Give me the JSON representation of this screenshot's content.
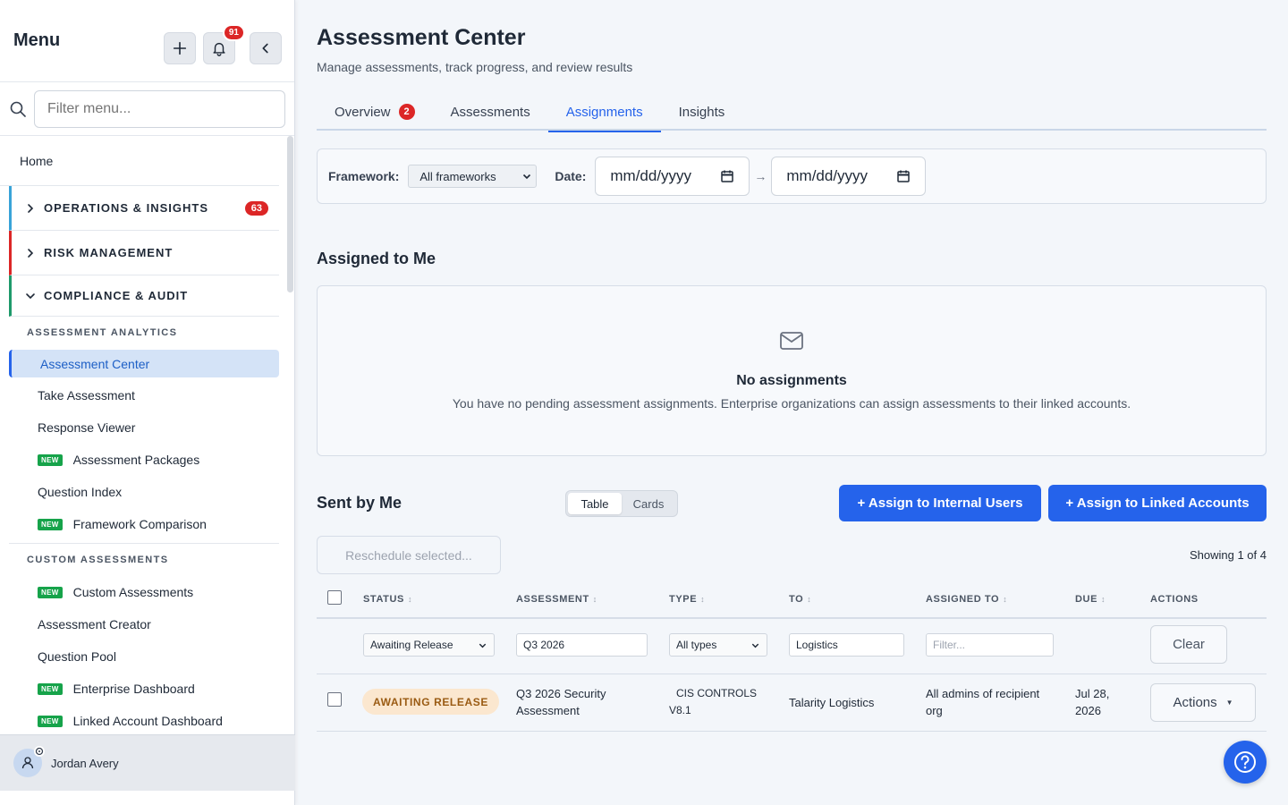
{
  "sidebar": {
    "title": "Menu",
    "notification_count": "91",
    "search_placeholder": "Filter menu...",
    "home": "Home",
    "sections": [
      {
        "label": "OPERATIONS & INSIGHTS",
        "badge": "63",
        "color": "#38a3d8"
      },
      {
        "label": "RISK MANAGEMENT",
        "color": "#dc2626"
      },
      {
        "label": "COMPLIANCE & AUDIT",
        "color": "#1e9a6b"
      }
    ],
    "groups": [
      {
        "label": "ASSESSMENT ANALYTICS",
        "items": [
          {
            "label": "Assessment Center",
            "active": true
          },
          {
            "label": "Take Assessment"
          },
          {
            "label": "Response Viewer"
          },
          {
            "label": "Assessment Packages",
            "new": true
          },
          {
            "label": "Question Index"
          },
          {
            "label": "Framework Comparison",
            "new": true
          }
        ]
      },
      {
        "label": "CUSTOM ASSESSMENTS",
        "items": [
          {
            "label": "Custom Assessments",
            "new": true
          },
          {
            "label": "Assessment Creator"
          },
          {
            "label": "Question Pool"
          },
          {
            "label": "Enterprise Dashboard",
            "new": true
          },
          {
            "label": "Linked Account Dashboard",
            "new": true
          }
        ]
      }
    ],
    "new_label": "NEW",
    "user": "Jordan Avery"
  },
  "page": {
    "title": "Assessment Center",
    "subtitle": "Manage assessments, track progress, and review results"
  },
  "tabs": [
    {
      "label": "Overview",
      "badge": "2"
    },
    {
      "label": "Assessments"
    },
    {
      "label": "Assignments",
      "active": true
    },
    {
      "label": "Insights"
    }
  ],
  "filters": {
    "framework_label": "Framework:",
    "framework_value": "All frameworks",
    "date_label": "Date:",
    "date_from": "mm/dd/yyyy",
    "date_to": "mm/dd/yyyy",
    "arrow": "→"
  },
  "assigned": {
    "title": "Assigned to Me",
    "empty_title": "No assignments",
    "empty_text": "You have no pending assessment assignments. Enterprise organizations can assign assessments to their linked accounts."
  },
  "sent": {
    "title": "Sent by Me",
    "view_table": "Table",
    "view_cards": "Cards",
    "assign_internal": "+ Assign to Internal Users",
    "assign_linked": "+ Assign to Linked Accounts",
    "reschedule": "Reschedule selected...",
    "showing": "Showing 1 of 4"
  },
  "table": {
    "columns": [
      "STATUS",
      "ASSESSMENT",
      "TYPE",
      "TO",
      "ASSIGNED TO",
      "DUE",
      "ACTIONS"
    ],
    "filters": {
      "status": "Awaiting Release",
      "assessment": "Q3 2026",
      "type": "All types",
      "to": "Logistics",
      "assigned_placeholder": "Filter...",
      "clear": "Clear"
    },
    "rows": [
      {
        "status": "AWAITING RELEASE",
        "assessment_line1": "Q3 2026 Security",
        "assessment_line2": "Assessment",
        "type_line1": "CIS CONTROLS",
        "type_line2": "V8.1",
        "to": "Talarity Logistics",
        "assigned_line1": "All admins of recipient",
        "assigned_line2": "org",
        "due_line1": "Jul 28,",
        "due_line2": "2026",
        "actions": "Actions"
      }
    ]
  },
  "colors": {
    "primary": "#2563eb",
    "danger": "#dc2626",
    "new": "#16a34a",
    "status_bg": "#fbe7cf",
    "status_text": "#9a5b13"
  }
}
